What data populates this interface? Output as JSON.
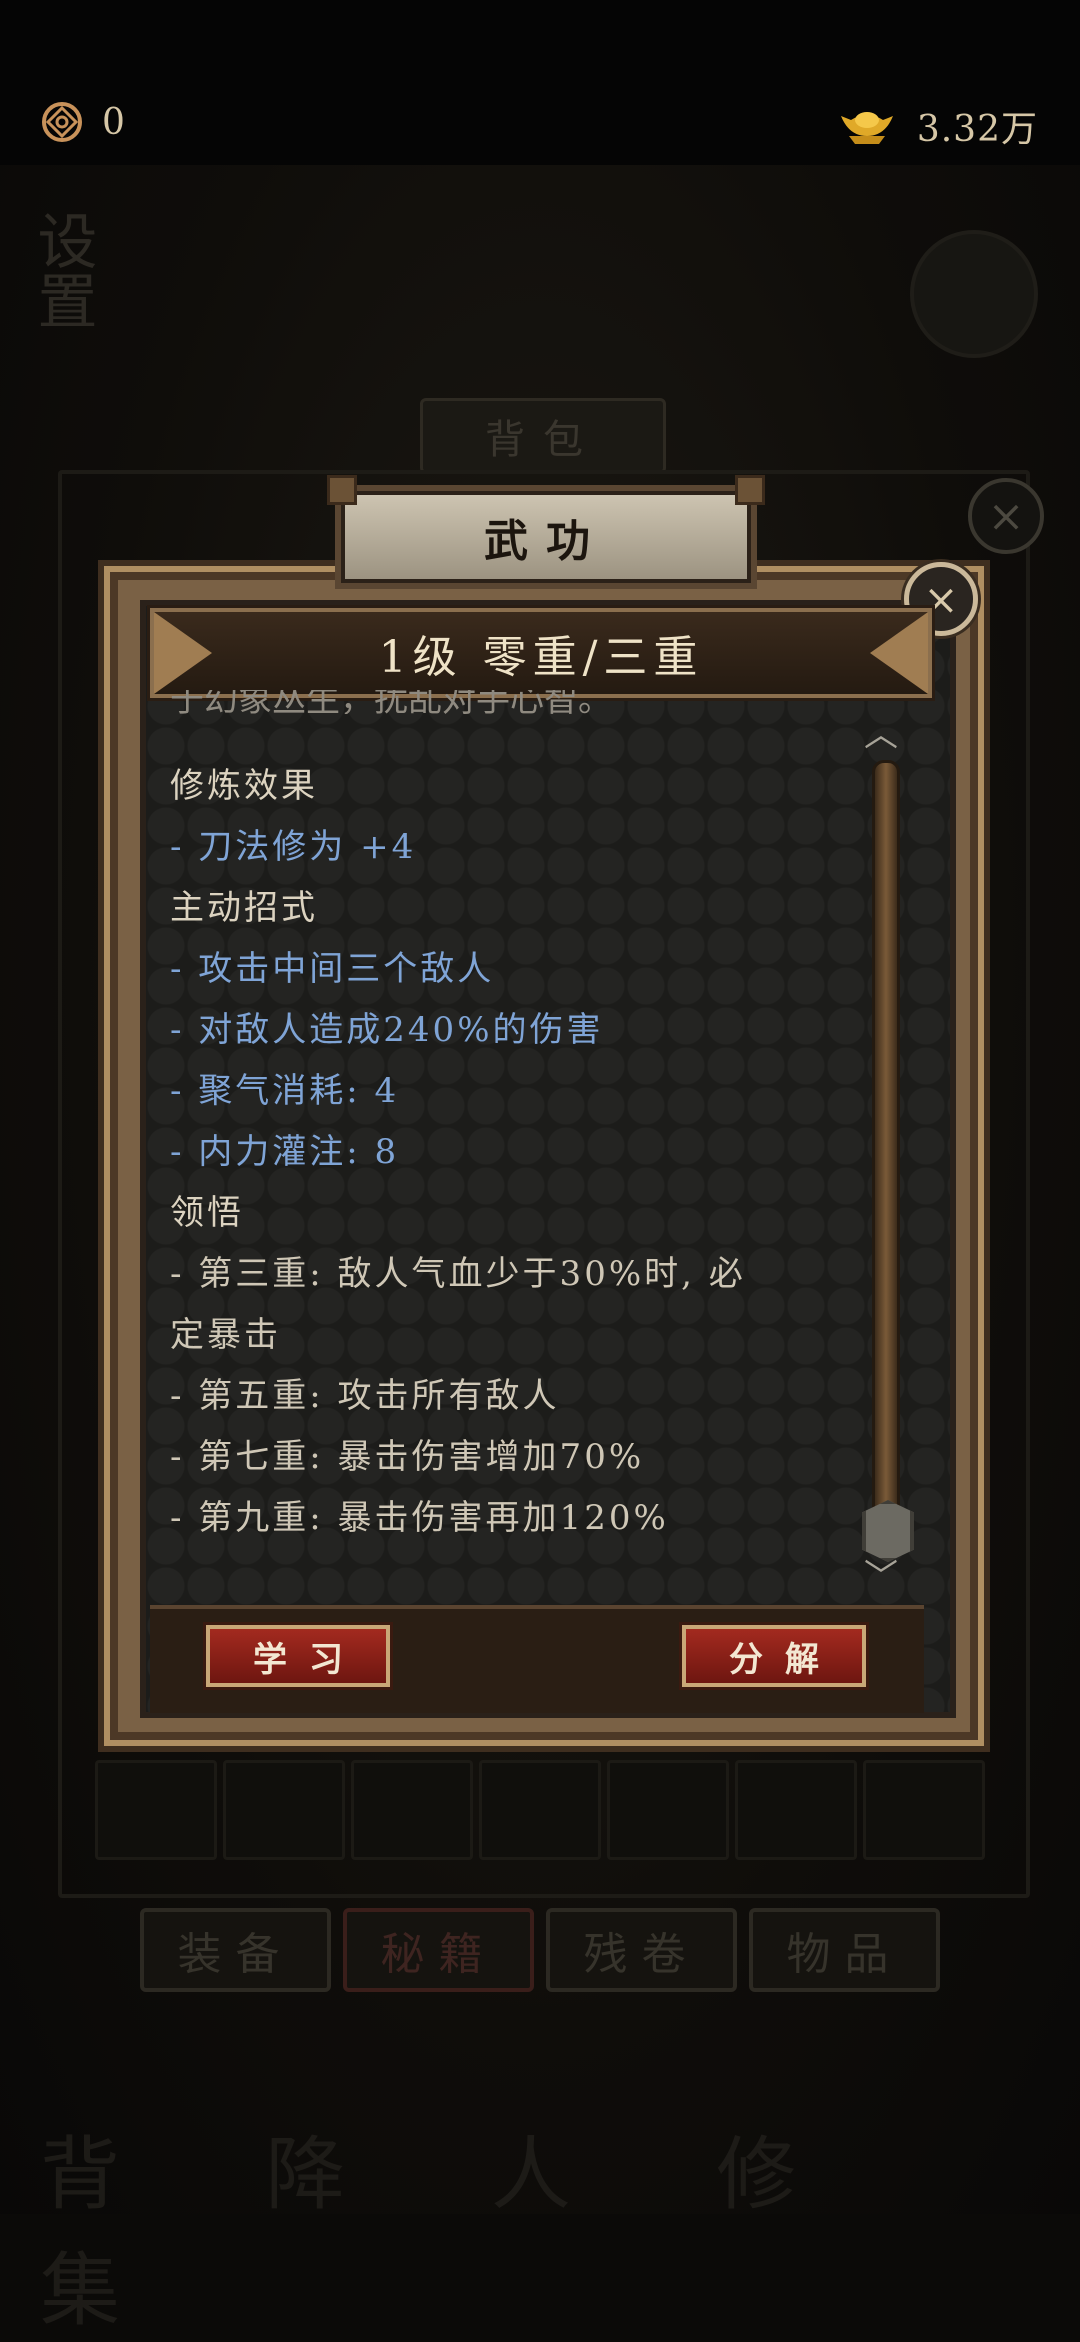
{
  "status_bar": {
    "coin_value": "0",
    "gold_value": "3.32万"
  },
  "background": {
    "title": "设置",
    "panel_title": "背包",
    "tabs": [
      "装备",
      "秘籍",
      "残卷",
      "物品"
    ],
    "active_tab_index": 1,
    "bottom_text": "背 降 人 修 集"
  },
  "dialog": {
    "tab_title": "武功",
    "header": "1级 零重/三重",
    "clipped_text": "于幻象丛生，扰乱对手心智。",
    "sections": [
      {
        "style": "head",
        "text": "修炼效果"
      },
      {
        "style": "blue",
        "text": "- 刀法修为 +4"
      },
      {
        "style": "head",
        "text": "主动招式"
      },
      {
        "style": "blue",
        "text": "- 攻击中间三个敌人"
      },
      {
        "style": "blue",
        "text": "- 对敌人造成240%的伤害"
      },
      {
        "style": "blue",
        "text": "- 聚气消耗: 4"
      },
      {
        "style": "blue",
        "text": "- 内力灌注: 8"
      },
      {
        "style": "head",
        "text": "领悟"
      },
      {
        "style": "grey",
        "text": "- 第三重: 敌人气血少于30%时, 必"
      },
      {
        "style": "grey",
        "text": "定暴击"
      },
      {
        "style": "grey",
        "text": "- 第五重: 攻击所有敌人"
      },
      {
        "style": "grey",
        "text": "- 第七重: 暴击伤害增加70%"
      },
      {
        "style": "grey",
        "text": "- 第九重: 暴击伤害再加120%"
      }
    ],
    "learn_label": "学习",
    "decompose_label": "分解"
  }
}
